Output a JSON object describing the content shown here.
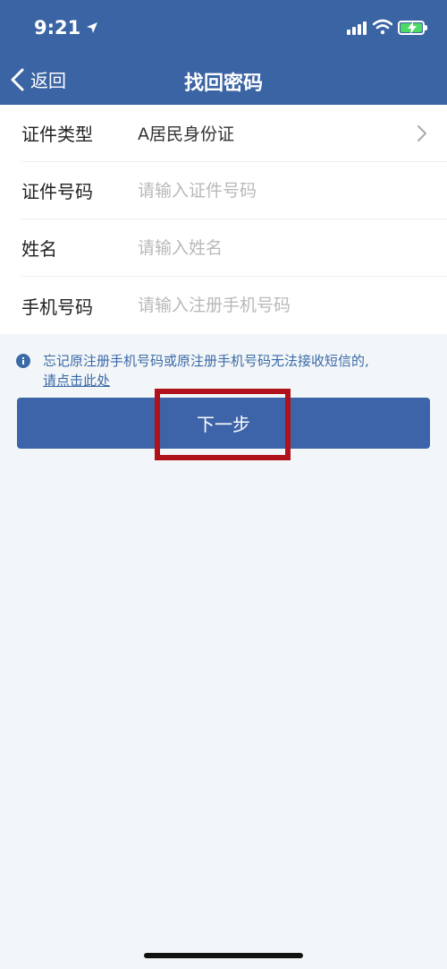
{
  "status_bar": {
    "time": "9:21"
  },
  "nav": {
    "back_label": "返回",
    "title": "找回密码"
  },
  "form": {
    "id_type": {
      "label": "证件类型",
      "value": "A居民身份证"
    },
    "id_number": {
      "label": "证件号码",
      "placeholder": "请输入证件号码"
    },
    "name": {
      "label": "姓名",
      "placeholder": "请输入姓名"
    },
    "phone": {
      "label": "手机号码",
      "placeholder": "请输入注册手机号码"
    }
  },
  "notice": {
    "text": "忘记原注册手机号码或原注册手机号码无法接收短信的,",
    "link": "请点击此处"
  },
  "next_button": {
    "label": "下一步"
  },
  "colors": {
    "header_bg": "#3b64a4",
    "button_bg": "#3d64a8",
    "notice_text": "#3a6aa8",
    "highlight_border": "#b0121b",
    "page_bg": "#f3f6f8"
  }
}
